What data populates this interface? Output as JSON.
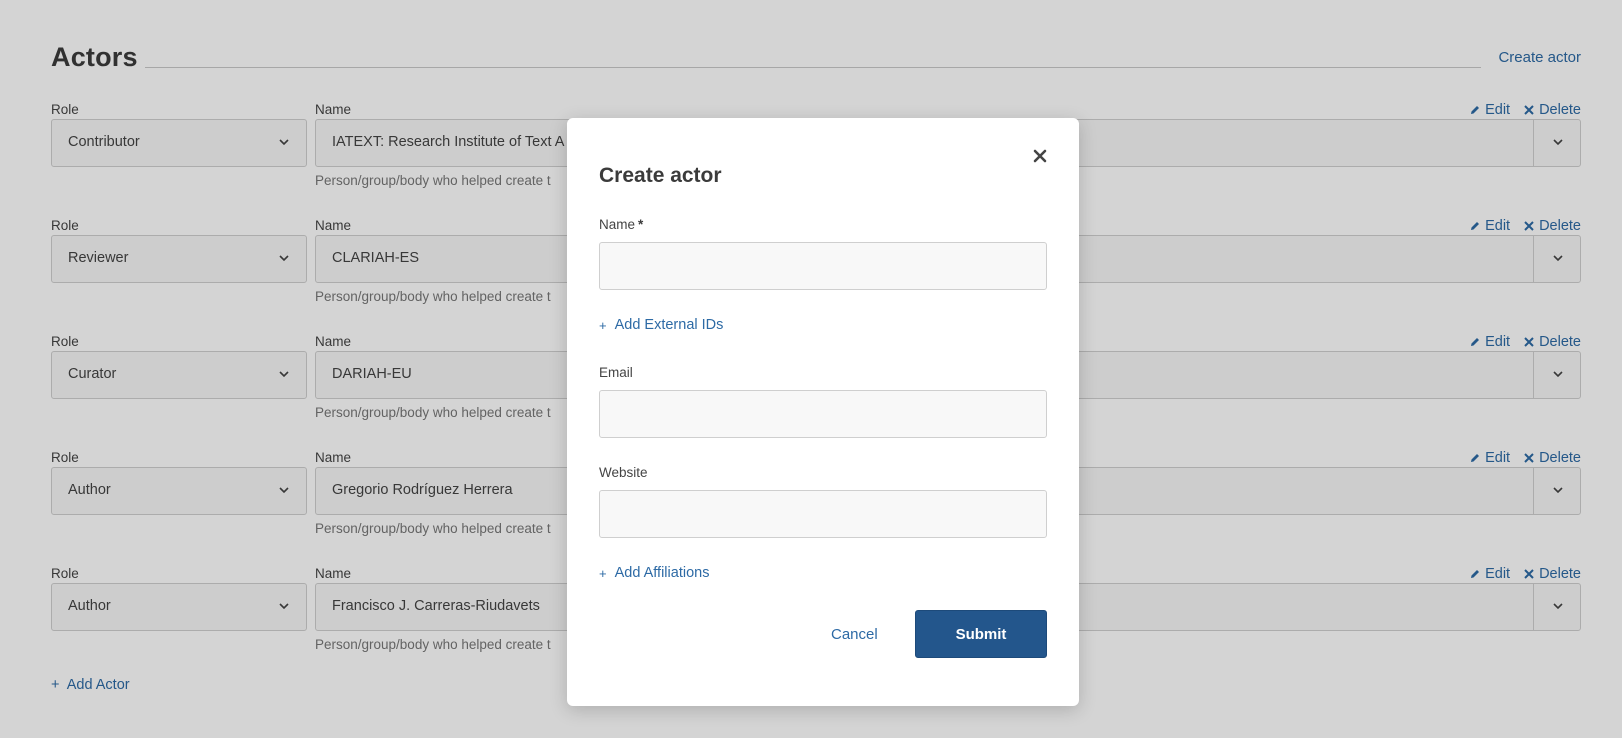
{
  "section": {
    "title": "Actors",
    "create_label": "Create actor"
  },
  "field_labels": {
    "role": "Role",
    "name": "Name"
  },
  "row_actions": {
    "edit": "Edit",
    "delete": "Delete"
  },
  "actors": [
    {
      "role": "Contributor",
      "name": "IATEXT: Research Institute of Text A",
      "help": "Person/group/body who helped create t"
    },
    {
      "role": "Reviewer",
      "name": "CLARIAH-ES",
      "help": "Person/group/body who helped create t"
    },
    {
      "role": "Curator",
      "name": "DARIAH-EU",
      "help": "Person/group/body who helped create t"
    },
    {
      "role": "Author",
      "name": "Gregorio Rodríguez Herrera",
      "help": "Person/group/body who helped create t"
    },
    {
      "role": "Author",
      "name": "Francisco J. Carreras-Riudavets",
      "help": "Person/group/body who helped create t"
    }
  ],
  "add_actor_label": "Add Actor",
  "modal": {
    "title": "Create actor",
    "name_label": "Name",
    "name_required_mark": "*",
    "name_value": "",
    "add_external_ids": "Add External IDs",
    "email_label": "Email",
    "email_value": "",
    "website_label": "Website",
    "website_value": "",
    "add_affiliations": "Add Affiliations",
    "cancel": "Cancel",
    "submit": "Submit"
  },
  "icons": {
    "close": "close-icon",
    "chevron": "chevron-down-icon",
    "edit": "pencil-icon",
    "delete": "x-icon",
    "add": "plus-icon"
  },
  "colors": {
    "link": "#2d6aa5",
    "primary_button": "#23568c",
    "overlay": "rgba(0,0,0,0.17)"
  }
}
